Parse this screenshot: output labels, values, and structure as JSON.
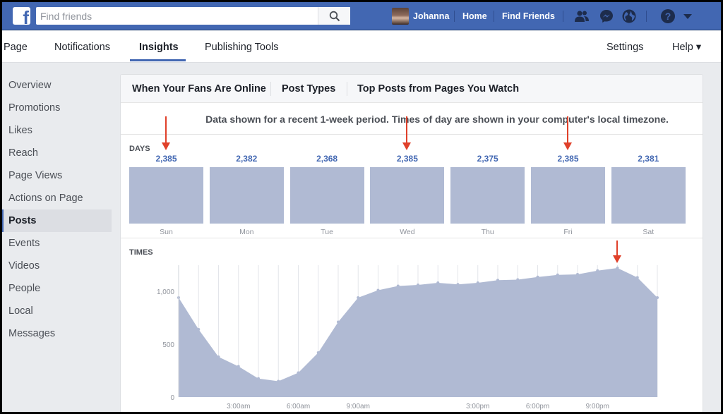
{
  "topbar": {
    "search_placeholder": "Find friends",
    "user_name": "Johanna",
    "home_label": "Home",
    "find_friends_label": "Find Friends"
  },
  "page_tabs": {
    "page": "Page",
    "notifications": "Notifications",
    "insights": "Insights",
    "publishing_tools": "Publishing Tools",
    "settings": "Settings",
    "help": "Help ▾"
  },
  "sidebar": {
    "items": [
      {
        "label": "Overview"
      },
      {
        "label": "Promotions"
      },
      {
        "label": "Likes"
      },
      {
        "label": "Reach"
      },
      {
        "label": "Page Views"
      },
      {
        "label": "Actions on Page"
      },
      {
        "label": "Posts"
      },
      {
        "label": "Events"
      },
      {
        "label": "Videos"
      },
      {
        "label": "People"
      },
      {
        "label": "Local"
      },
      {
        "label": "Messages"
      }
    ],
    "active_item": "Posts"
  },
  "subtabs": {
    "fans_online": "When Your Fans Are Online",
    "post_types": "Post Types",
    "top_posts": "Top Posts from Pages You Watch"
  },
  "note": "Data shown for a recent 1-week period. Times of day are shown in your computer's local timezone.",
  "days_label": "DAYS",
  "times_label": "TIMES",
  "colors": {
    "brand": "#4267b2",
    "bar": "#b0bad3",
    "arrow": "#e0402a"
  },
  "chart_data": [
    {
      "type": "bar",
      "categories": [
        "Sun",
        "Mon",
        "Tue",
        "Wed",
        "Thu",
        "Fri",
        "Sat"
      ],
      "values": [
        2385,
        2382,
        2368,
        2385,
        2375,
        2385,
        2381
      ],
      "data_labels": [
        "2,385",
        "2,382",
        "2,368",
        "2,385",
        "2,375",
        "2,385",
        "2,381"
      ],
      "title": "DAYS",
      "highlighted": [
        "Sun",
        "Wed",
        "Fri"
      ]
    },
    {
      "type": "area",
      "title": "TIMES",
      "x": [
        0,
        1,
        2,
        3,
        4,
        5,
        6,
        7,
        8,
        9,
        10,
        11,
        12,
        13,
        14,
        15,
        16,
        17,
        18,
        19,
        20,
        21,
        22,
        23
      ],
      "values": [
        940,
        640,
        380,
        290,
        175,
        150,
        230,
        420,
        710,
        940,
        1010,
        1050,
        1060,
        1080,
        1065,
        1080,
        1105,
        1110,
        1135,
        1155,
        1160,
        1195,
        1220,
        1130,
        940
      ],
      "x_tick_labels": [
        "3:00am",
        "6:00am",
        "9:00am",
        "3:00pm",
        "6:00pm",
        "9:00pm"
      ],
      "x_tick_positions": [
        3,
        6,
        9,
        15,
        18,
        21
      ],
      "y_ticks": [
        0,
        500,
        1000
      ],
      "y_tick_labels": [
        "0",
        "500",
        "1,000"
      ],
      "ylim": [
        0,
        1300
      ],
      "grid": true,
      "highlighted_hour": 22
    }
  ]
}
